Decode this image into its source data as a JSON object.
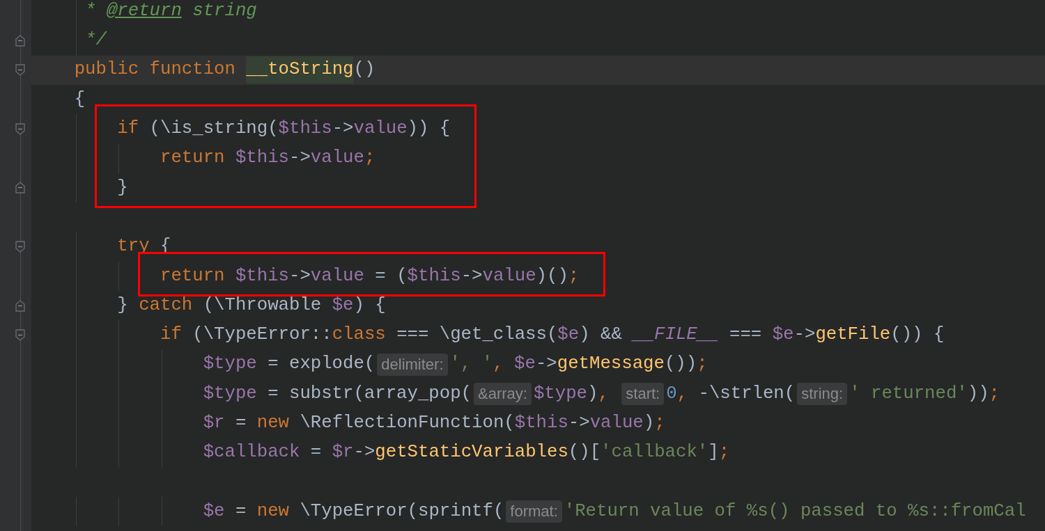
{
  "editor": {
    "lines": [
      {
        "kind": "code",
        "tokens": [
          {
            "kind": "doc",
            "text": "     * "
          },
          {
            "kind": "doctag",
            "text": "@return"
          },
          {
            "kind": "doc",
            "text": " string"
          }
        ]
      },
      {
        "kind": "code",
        "fold_end": true,
        "tokens": [
          {
            "kind": "doc",
            "text": "     */"
          }
        ]
      },
      {
        "kind": "code",
        "fold_start": true,
        "current": true,
        "tokens": [
          {
            "kind": "keyword",
            "text": "    public function "
          },
          {
            "kind": "function",
            "text": "__toString",
            "caret": true
          },
          {
            "kind": "plain",
            "text": "()"
          }
        ]
      },
      {
        "kind": "code",
        "tokens": [
          {
            "kind": "plain",
            "text": "    {"
          }
        ]
      },
      {
        "kind": "code",
        "fold_start": true,
        "boxed": true,
        "tokens": [
          {
            "kind": "keyword",
            "text": "        if "
          },
          {
            "kind": "plain",
            "text": "(\\is_string("
          },
          {
            "kind": "variable",
            "text": "$this"
          },
          {
            "kind": "plain",
            "text": "->"
          },
          {
            "kind": "field",
            "text": "value"
          },
          {
            "kind": "plain",
            "text": ")) {"
          }
        ]
      },
      {
        "kind": "code",
        "boxed": true,
        "tokens": [
          {
            "kind": "keyword",
            "text": "            return "
          },
          {
            "kind": "variable",
            "text": "$this"
          },
          {
            "kind": "plain",
            "text": "->"
          },
          {
            "kind": "field",
            "text": "value"
          },
          {
            "kind": "punct",
            "text": ";"
          }
        ]
      },
      {
        "kind": "code",
        "fold_end": true,
        "boxed": true,
        "tokens": [
          {
            "kind": "plain",
            "text": "        }"
          }
        ]
      },
      {
        "kind": "blank"
      },
      {
        "kind": "code",
        "fold_start": true,
        "tokens": [
          {
            "kind": "keyword",
            "text": "        try "
          },
          {
            "kind": "plain",
            "text": "{"
          }
        ]
      },
      {
        "kind": "code",
        "boxed": true,
        "tokens": [
          {
            "kind": "keyword",
            "text": "            return "
          },
          {
            "kind": "variable",
            "text": "$this"
          },
          {
            "kind": "plain",
            "text": "->"
          },
          {
            "kind": "field",
            "text": "value"
          },
          {
            "kind": "plain",
            "text": " = ("
          },
          {
            "kind": "variable",
            "text": "$this"
          },
          {
            "kind": "plain",
            "text": "->"
          },
          {
            "kind": "field",
            "text": "value"
          },
          {
            "kind": "plain",
            "text": ")()"
          },
          {
            "kind": "punct",
            "text": ";"
          }
        ]
      },
      {
        "kind": "code",
        "fold_end": true,
        "tokens": [
          {
            "kind": "plain",
            "text": "        } "
          },
          {
            "kind": "keyword",
            "text": "catch "
          },
          {
            "kind": "plain",
            "text": "(\\Throwable "
          },
          {
            "kind": "variable",
            "text": "$e"
          },
          {
            "kind": "plain",
            "text": ") {"
          }
        ]
      },
      {
        "kind": "code",
        "fold_start": true,
        "tokens": [
          {
            "kind": "keyword",
            "text": "            if "
          },
          {
            "kind": "plain",
            "text": "(\\TypeError::"
          },
          {
            "kind": "keyword",
            "text": "class"
          },
          {
            "kind": "plain",
            "text": " === \\get_class("
          },
          {
            "kind": "variable",
            "text": "$e"
          },
          {
            "kind": "plain",
            "text": ") && "
          },
          {
            "kind": "constant",
            "text": "__FILE__"
          },
          {
            "kind": "plain",
            "text": " === "
          },
          {
            "kind": "variable",
            "text": "$e"
          },
          {
            "kind": "plain",
            "text": "->"
          },
          {
            "kind": "function",
            "text": "getFile"
          },
          {
            "kind": "plain",
            "text": "()) {"
          }
        ]
      },
      {
        "kind": "code",
        "tokens": [
          {
            "kind": "variable",
            "text": "                $type"
          },
          {
            "kind": "plain",
            "text": " = explode("
          },
          {
            "kind": "hint",
            "text": "delimiter:"
          },
          {
            "kind": "string",
            "text": "', '"
          },
          {
            "kind": "punct",
            "text": ", "
          },
          {
            "kind": "variable",
            "text": "$e"
          },
          {
            "kind": "plain",
            "text": "->"
          },
          {
            "kind": "function",
            "text": "getMessage"
          },
          {
            "kind": "plain",
            "text": "())"
          },
          {
            "kind": "punct",
            "text": ";"
          }
        ]
      },
      {
        "kind": "code",
        "tokens": [
          {
            "kind": "variable",
            "text": "                $type"
          },
          {
            "kind": "plain",
            "text": " = substr(array_pop("
          },
          {
            "kind": "hint",
            "text": "&array:"
          },
          {
            "kind": "variable",
            "text": "$type"
          },
          {
            "kind": "plain",
            "text": ")"
          },
          {
            "kind": "punct",
            "text": ", "
          },
          {
            "kind": "hint",
            "text": "start:"
          },
          {
            "kind": "number",
            "text": "0"
          },
          {
            "kind": "punct",
            "text": ", "
          },
          {
            "kind": "plain",
            "text": "-\\strlen("
          },
          {
            "kind": "hint",
            "text": "string:"
          },
          {
            "kind": "string",
            "text": "' returned'"
          },
          {
            "kind": "plain",
            "text": "))"
          },
          {
            "kind": "punct",
            "text": ";"
          }
        ]
      },
      {
        "kind": "code",
        "tokens": [
          {
            "kind": "variable",
            "text": "                $r"
          },
          {
            "kind": "plain",
            "text": " = "
          },
          {
            "kind": "keyword",
            "text": "new "
          },
          {
            "kind": "plain",
            "text": "\\ReflectionFunction("
          },
          {
            "kind": "variable",
            "text": "$this"
          },
          {
            "kind": "plain",
            "text": "->"
          },
          {
            "kind": "field",
            "text": "value"
          },
          {
            "kind": "plain",
            "text": ")"
          },
          {
            "kind": "punct",
            "text": ";"
          }
        ]
      },
      {
        "kind": "code",
        "tokens": [
          {
            "kind": "variable",
            "text": "                $callback"
          },
          {
            "kind": "plain",
            "text": " = "
          },
          {
            "kind": "variable",
            "text": "$r"
          },
          {
            "kind": "plain",
            "text": "->"
          },
          {
            "kind": "function",
            "text": "getStaticVariables"
          },
          {
            "kind": "plain",
            "text": "()["
          },
          {
            "kind": "string",
            "text": "'callback'"
          },
          {
            "kind": "plain",
            "text": "]"
          },
          {
            "kind": "punct",
            "text": ";"
          }
        ]
      },
      {
        "kind": "blank"
      },
      {
        "kind": "code",
        "tokens": [
          {
            "kind": "variable",
            "text": "                $e"
          },
          {
            "kind": "plain",
            "text": " = "
          },
          {
            "kind": "keyword",
            "text": "new "
          },
          {
            "kind": "plain",
            "text": "\\TypeError(sprintf("
          },
          {
            "kind": "hint",
            "text": "format:"
          },
          {
            "kind": "string",
            "text": "'Return value of %s() passed to %s::fromCal"
          }
        ]
      }
    ]
  }
}
